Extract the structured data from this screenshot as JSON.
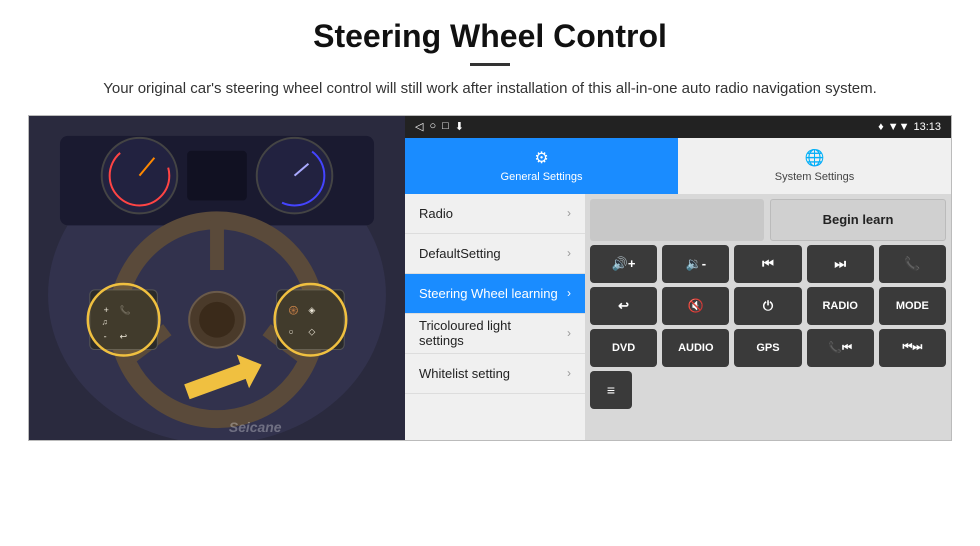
{
  "header": {
    "title": "Steering Wheel Control",
    "subtitle": "Your original car's steering wheel control will still work after installation of this all-in-one auto radio navigation system."
  },
  "status_bar": {
    "back_icon": "◁",
    "home_icon": "○",
    "recent_icon": "□",
    "download_icon": "⬇",
    "signal_icon": "▼▼",
    "wifi_icon": "▾",
    "time": "13:13"
  },
  "tabs": [
    {
      "id": "general",
      "label": "General Settings",
      "icon": "⚙",
      "active": true
    },
    {
      "id": "system",
      "label": "System Settings",
      "icon": "🌐",
      "active": false
    }
  ],
  "menu_items": [
    {
      "id": "radio",
      "label": "Radio",
      "active": false
    },
    {
      "id": "default-setting",
      "label": "DefaultSetting",
      "active": false
    },
    {
      "id": "steering-wheel",
      "label": "Steering Wheel learning",
      "active": true
    },
    {
      "id": "tricoloured",
      "label": "Tricoloured light settings",
      "active": false
    },
    {
      "id": "whitelist",
      "label": "Whitelist setting",
      "active": false
    }
  ],
  "controls": {
    "begin_learn_label": "Begin learn",
    "buttons_row1": [
      "🔊+",
      "🔊-",
      "⏮",
      "⏭",
      "📞"
    ],
    "buttons_row2": [
      "↩",
      "🔇",
      "⏻",
      "RADIO",
      "MODE"
    ],
    "buttons_row3": [
      "DVD",
      "AUDIO",
      "GPS",
      "📞⏮",
      "⏮⏭"
    ],
    "buttons_row4": [
      "≡"
    ]
  },
  "watermark": "Seicane"
}
